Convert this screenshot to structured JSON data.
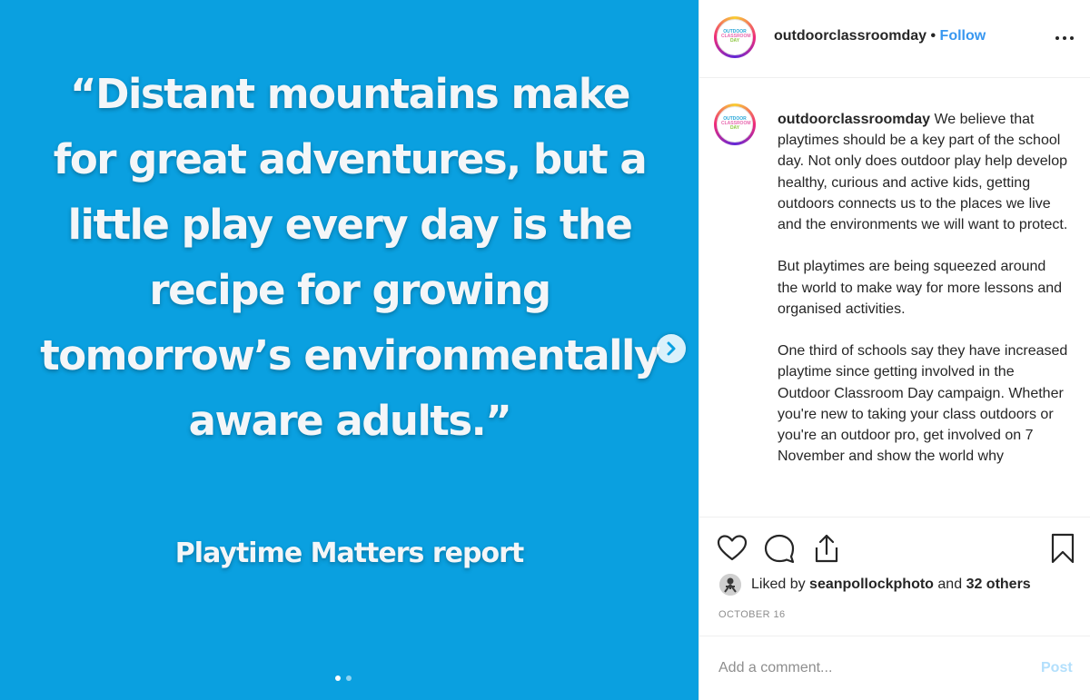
{
  "media": {
    "quote": "“Distant mountains make for great adventures, but a little play every day is the recipe for growing tomorrow’s environmentally aware adults.”",
    "source": "Playtime Matters report",
    "background_color": "#0aa0e0",
    "slide_current": 1,
    "slide_total": 2
  },
  "header": {
    "username": "outdoorclassroomday",
    "separator": "•",
    "follow_label": "Follow"
  },
  "avatar_logo": {
    "line1": "OUTDOOR",
    "line2": "CLASSROOM",
    "line3": "DAY"
  },
  "caption": {
    "author": "outdoorclassroomday",
    "text": "We believe that playtimes should be a key part of the school day. Not only does outdoor play help develop healthy, curious and active kids, getting outdoors connects us to the places we live and the environments we will want to protect.\n\nBut playtimes are being squeezed around the world to make way for more lessons and organised activities.\n\nOne third of schools say they have increased playtime since getting involved in the Outdoor Classroom Day campaign. Whether you're new to taking your class outdoors or you're an outdoor pro, get involved on 7 November and show the world why"
  },
  "actions": {
    "icons": [
      "heart-icon",
      "comment-icon",
      "share-icon",
      "bookmark-icon"
    ]
  },
  "likes": {
    "prefix": "Liked by",
    "user": "sean­pollockphoto",
    "middle": "and",
    "others": "32 others"
  },
  "date": "OCTOBER 16",
  "comment": {
    "placeholder": "Add a comment...",
    "post_label": "Post"
  },
  "colors": {
    "accent": "#3897f0",
    "post_disabled": "#b2dffc",
    "text": "#262626",
    "muted": "#8e8e8e"
  }
}
